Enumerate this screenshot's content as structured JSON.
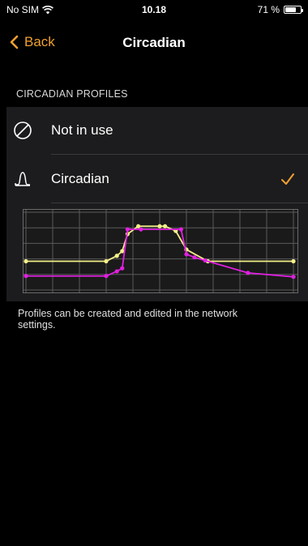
{
  "status_bar": {
    "carrier": "No SIM",
    "time": "10.18",
    "battery_text": "71 %",
    "battery_level": 0.71,
    "wifi_icon": "wifi-icon",
    "battery_icon": "battery-icon"
  },
  "nav": {
    "back_label": "Back",
    "back_icon": "chevron-left-icon",
    "title": "Circadian",
    "accent_color": "#f0a030"
  },
  "section": {
    "header": "CIRCADIAN PROFILES"
  },
  "profiles": [
    {
      "label": "Not in use",
      "icon": "not-in-use-icon",
      "selected": false
    },
    {
      "label": "Circadian",
      "icon": "circadian-curve-icon",
      "selected": true
    }
  ],
  "chart_data": {
    "type": "line",
    "title": "",
    "xlabel": "",
    "ylabel": "",
    "grid": true,
    "xlim": [
      0,
      10
    ],
    "ylim": [
      0,
      5
    ],
    "series": [
      {
        "color": "#f5f08a",
        "x": [
          0,
          3.0,
          3.4,
          3.6,
          3.8,
          4.2,
          5.0,
          5.2,
          5.6,
          6.0,
          6.8,
          10
        ],
        "y": [
          1.85,
          1.85,
          2.2,
          2.5,
          3.6,
          4.1,
          4.1,
          4.1,
          3.8,
          2.6,
          1.85,
          1.85
        ]
      },
      {
        "color": "#e020e0",
        "x": [
          0,
          3.0,
          3.4,
          3.6,
          3.8,
          4.3,
          5.8,
          6.0,
          6.3,
          6.7,
          8.3,
          10
        ],
        "y": [
          0.9,
          0.9,
          1.2,
          1.4,
          3.9,
          3.9,
          3.9,
          2.3,
          2.1,
          1.9,
          1.1,
          0.85
        ]
      }
    ]
  },
  "footer": {
    "text": "Profiles can be created and edited in the network settings."
  }
}
